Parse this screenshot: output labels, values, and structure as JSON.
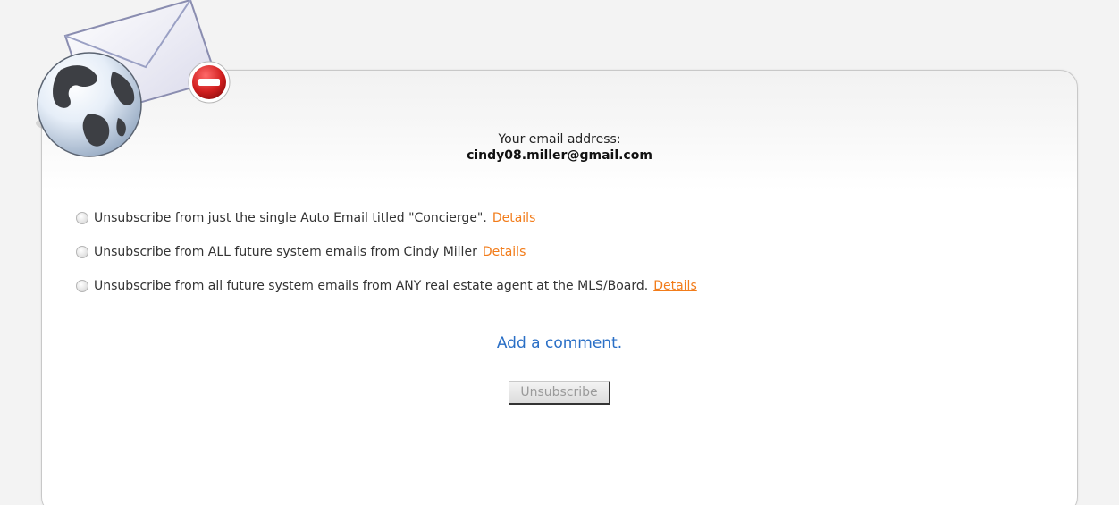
{
  "header": {
    "email_label": "Your email address:",
    "email_value": "cindy08.miller@gmail.com"
  },
  "options": [
    {
      "label": "Unsubscribe from just the single Auto Email titled \"Concierge\".",
      "details": "Details"
    },
    {
      "label": "Unsubscribe from ALL future system emails from Cindy Miller",
      "details": "Details"
    },
    {
      "label": "Unsubscribe from all future system emails from ANY real estate agent at the MLS/Board.",
      "details": "Details"
    }
  ],
  "comment_link": "Add a comment.",
  "unsubscribe_button": "Unsubscribe",
  "icons": {
    "logo": "envelope-globe-icon",
    "badge": "no-entry-icon"
  },
  "colors": {
    "details_link": "#f27c1a",
    "comment_link": "#2a6fc6",
    "badge_red": "#c62020"
  }
}
